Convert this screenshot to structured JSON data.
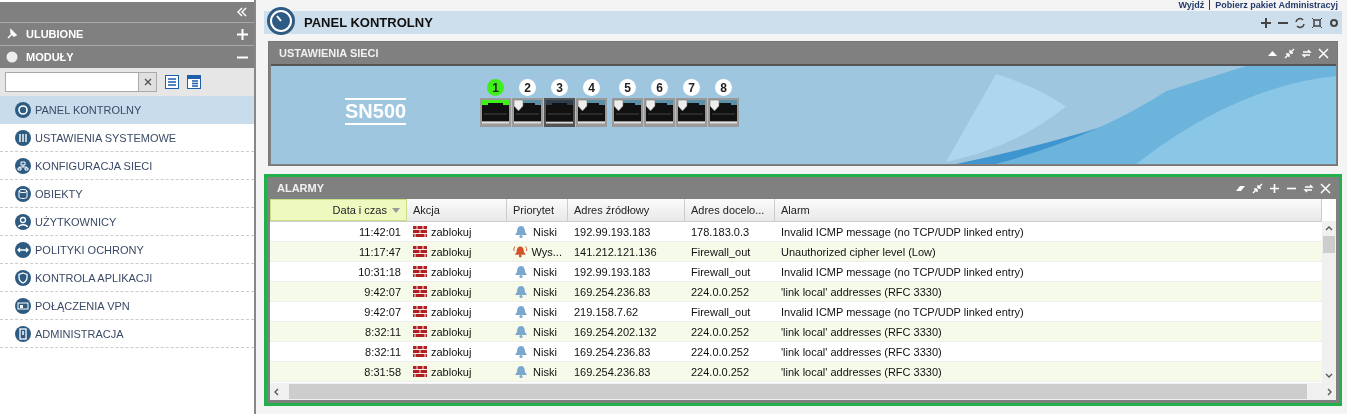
{
  "header_links": [
    "Wyjdź",
    "Pobierz pakiet Administracyj"
  ],
  "sidebar": {
    "sections": [
      {
        "label": "ULUBIONE",
        "expanded": false
      },
      {
        "label": "MODUŁY",
        "expanded": true
      }
    ],
    "items": [
      {
        "label": "PANEL KONTROLNY",
        "selected": true
      },
      {
        "label": "USTAWIENIA SYSTEMOWE",
        "selected": false
      },
      {
        "label": "KONFIGURACJA SIECI",
        "selected": false
      },
      {
        "label": "OBIEKTY",
        "selected": false
      },
      {
        "label": "UŻYTKOWNICY",
        "selected": false
      },
      {
        "label": "POLITYKI OCHRONY",
        "selected": false
      },
      {
        "label": "KONTROLA APLIKACJI",
        "selected": false
      },
      {
        "label": "POŁĄCZENIA VPN",
        "selected": false
      },
      {
        "label": "ADMINISTRACJA",
        "selected": false
      }
    ]
  },
  "page_title": "PANEL KONTROLNY",
  "network_panel": {
    "title": "USTAWIENIA SIECI",
    "model": "SN500",
    "ports": [
      {
        "number": "1",
        "kind": "connected"
      },
      {
        "number": "2",
        "kind": "protected"
      },
      {
        "number": "3",
        "kind": "unused"
      },
      {
        "number": "4",
        "kind": "protected"
      },
      {
        "number": "5",
        "kind": "protected"
      },
      {
        "number": "6",
        "kind": "protected"
      },
      {
        "number": "7",
        "kind": "protected"
      },
      {
        "number": "8",
        "kind": "protected"
      }
    ]
  },
  "alarms_panel": {
    "title": "ALARMY",
    "columns": [
      {
        "label": "Data i czas",
        "sorted": true
      },
      {
        "label": "Akcja",
        "sorted": false
      },
      {
        "label": "Priorytet",
        "sorted": false
      },
      {
        "label": "Adres źródłowy",
        "sorted": false
      },
      {
        "label": "Adres docelo...",
        "sorted": false
      },
      {
        "label": "Alarm",
        "sorted": false
      }
    ],
    "rows": [
      {
        "time": "11:42:01",
        "action": "zablokuj",
        "priority": "Niski",
        "kind": "low",
        "source": "192.99.193.183",
        "destination": "178.183.0.3",
        "alarm": "Invalid ICMP message (no TCP/UDP linked entry)"
      },
      {
        "time": "11:17:47",
        "action": "zablokuj",
        "priority": "Wys...",
        "kind": "high",
        "source": "141.212.121.136",
        "destination": "Firewall_out",
        "alarm": "Unauthorized cipher level (Low)"
      },
      {
        "time": "10:31:18",
        "action": "zablokuj",
        "priority": "Niski",
        "kind": "low",
        "source": "192.99.193.183",
        "destination": "Firewall_out",
        "alarm": "Invalid ICMP message (no TCP/UDP linked entry)"
      },
      {
        "time": "9:42:07",
        "action": "zablokuj",
        "priority": "Niski",
        "kind": "low",
        "source": "169.254.236.83",
        "destination": "224.0.0.252",
        "alarm": "'link local' addresses (RFC 3330)"
      },
      {
        "time": "9:42:07",
        "action": "zablokuj",
        "priority": "Niski",
        "kind": "low",
        "source": "219.158.7.62",
        "destination": "Firewall_out",
        "alarm": "Invalid ICMP message (no TCP/UDP linked entry)"
      },
      {
        "time": "8:32:11",
        "action": "zablokuj",
        "priority": "Niski",
        "kind": "low",
        "source": "169.254.202.132",
        "destination": "224.0.0.252",
        "alarm": "'link local' addresses (RFC 3330)"
      },
      {
        "time": "8:32:11",
        "action": "zablokuj",
        "priority": "Niski",
        "kind": "low",
        "source": "169.254.236.83",
        "destination": "224.0.0.252",
        "alarm": "'link local' addresses (RFC 3330)"
      },
      {
        "time": "8:31:58",
        "action": "zablokuj",
        "priority": "Niski",
        "kind": "low",
        "source": "169.254.236.83",
        "destination": "224.0.0.252",
        "alarm": "'link local' addresses (RFC 3330)"
      }
    ]
  }
}
